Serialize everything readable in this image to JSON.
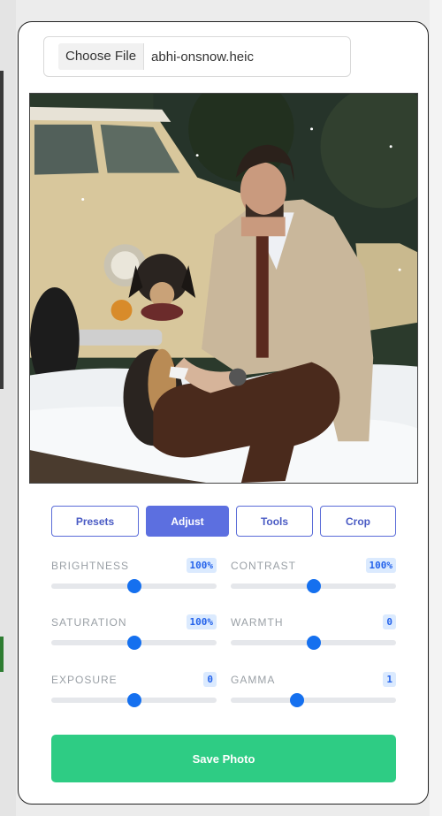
{
  "file_input": {
    "button_label": "Choose File",
    "file_name": "abhi-onsnow.heic"
  },
  "photo": {
    "alt": "Man in beige coat sitting on snow with a dog beside a vintage car"
  },
  "tabs": [
    {
      "label": "Presets",
      "active": false
    },
    {
      "label": "Adjust",
      "active": true
    },
    {
      "label": "Tools",
      "active": false
    },
    {
      "label": "Crop",
      "active": false
    }
  ],
  "adjustments": [
    {
      "label": "BRIGHTNESS",
      "value": "100%",
      "level": 0.5
    },
    {
      "label": "CONTRAST",
      "value": "100%",
      "level": 0.5
    },
    {
      "label": "SATURATION",
      "value": "100%",
      "level": 0.5
    },
    {
      "label": "WARMTH",
      "value": "0",
      "level": 0.5
    },
    {
      "label": "EXPOSURE",
      "value": "0",
      "level": 0.5
    },
    {
      "label": "GAMMA",
      "value": "1",
      "level": 0.4
    }
  ],
  "save_label": "Save Photo",
  "colors": {
    "accent": "#5c6fe0",
    "save": "#2ecc84",
    "slider": "#1570ef"
  }
}
